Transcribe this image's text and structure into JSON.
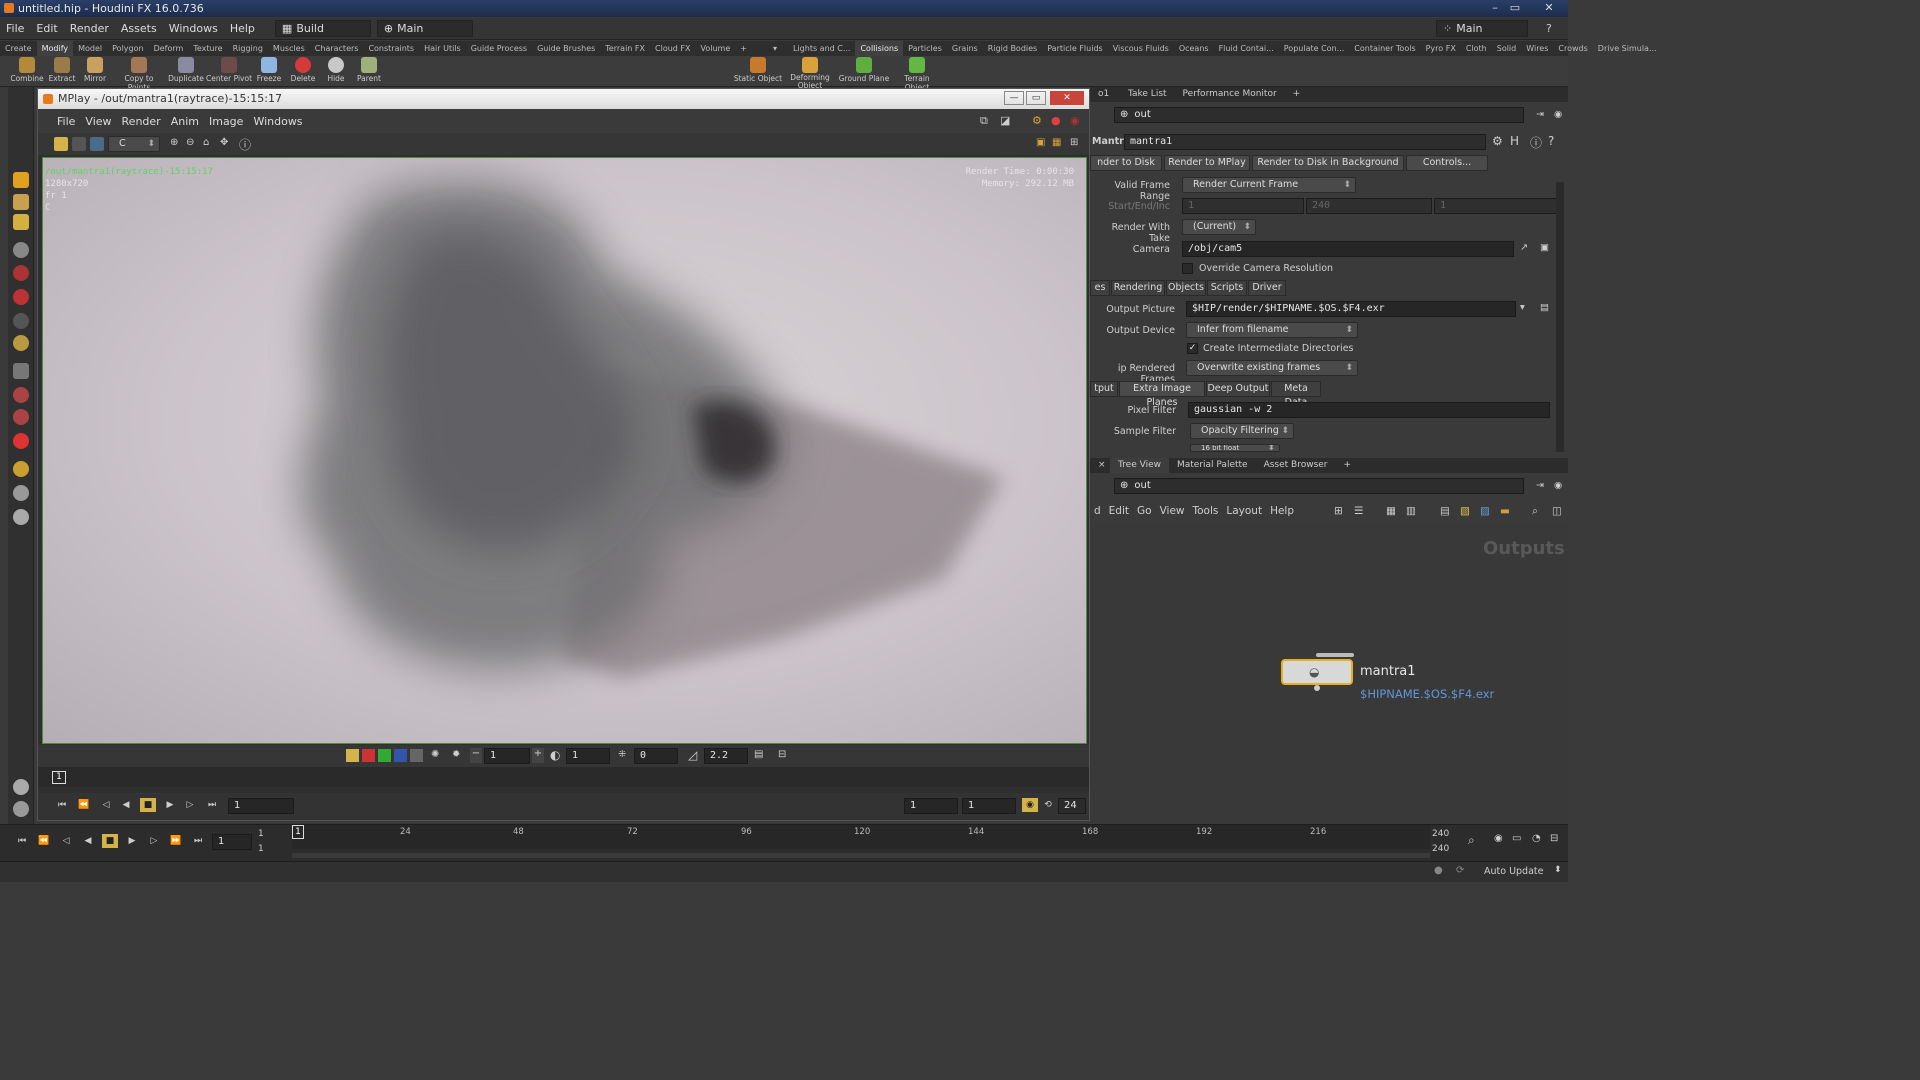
{
  "window": {
    "title": "untitled.hip - Houdini FX 16.0.736"
  },
  "menubar": {
    "items": [
      "File",
      "Edit",
      "Render",
      "Assets",
      "Windows",
      "Help"
    ],
    "desktop": "Build",
    "network": "Main",
    "right_desktop": "Main"
  },
  "shelf": {
    "tabs_left": [
      "Create",
      "Modify",
      "Model",
      "Polygon",
      "Deform",
      "Texture",
      "Rigging",
      "Muscles",
      "Characters",
      "Constraints",
      "Hair Utils",
      "Guide Process",
      "Guide Brushes",
      "Terrain FX",
      "Cloud FX",
      "Volume"
    ],
    "tabs_right": [
      "Lights and C...",
      "Collisions",
      "Particles",
      "Grains",
      "Rigid Bodies",
      "Particle Fluids",
      "Viscous Fluids",
      "Oceans",
      "Fluid Contai...",
      "Populate Con...",
      "Container Tools",
      "Pyro FX",
      "Cloth",
      "Solid",
      "Wires",
      "Crowds",
      "Drive Simula..."
    ],
    "tools_left": [
      "Combine",
      "Extract",
      "Mirror",
      "Copy to Points",
      "Duplicate",
      "Center Pivot",
      "Freeze",
      "Delete",
      "Hide",
      "Parent"
    ],
    "tools_right": [
      "Static Object",
      "Deforming Object",
      "Ground Plane",
      "Terrain Object"
    ]
  },
  "mplay": {
    "title": "MPlay - /out/mantra1(raytrace)-15:15:17",
    "menu": [
      "File",
      "View",
      "Render",
      "Anim",
      "Image",
      "Windows"
    ],
    "channel": "C",
    "overlay_left": [
      "/out/mantra1(raytrace)-15:15:17",
      "1280x720",
      "fr 1",
      "C"
    ],
    "render_time": "Render Time: 0:00:30",
    "memory": "Memory:  292.12 MB",
    "gamma": "2.2",
    "exposure_fields": [
      "1",
      "1",
      "0"
    ],
    "frame_marker": "1",
    "play_frame": "1",
    "range_start": "1",
    "range_end": "1",
    "fps": "24"
  },
  "right_tabs_top": [
    "Take List",
    "Performance Monitor"
  ],
  "path_top": "out",
  "node": {
    "type": "Mantra",
    "name": "mantra1"
  },
  "buttons": {
    "render_to_disk": "nder to Disk",
    "render_to_mplay": "Render to MPlay",
    "render_bg": "Render to Disk in Background",
    "controls": "Controls..."
  },
  "params": {
    "valid_frame_range_label": "Valid Frame Range",
    "valid_frame_range": "Render Current Frame",
    "start_end_label": "Start/End/Inc",
    "start": "1",
    "end": "240",
    "inc": "1",
    "take_label": "Render With Take",
    "take": "(Current)",
    "camera_label": "Camera",
    "camera": "/obj/cam5",
    "override_label": "Override Camera Resolution",
    "tabs": [
      "es",
      "Rendering",
      "Objects",
      "Scripts",
      "Driver"
    ],
    "output_picture_label": "Output Picture",
    "output_picture": "$HIP/render/$HIPNAME.$OS.$F4.exr",
    "output_device_label": "Output Device",
    "output_device": "Infer from filename",
    "create_dirs_label": "Create Intermediate Directories",
    "skip_label": "ip Rendered Frames",
    "skip": "Overwrite existing frames",
    "subtabs": [
      "tput",
      "Extra Image Planes",
      "Deep Output",
      "Meta Data"
    ],
    "pixel_filter_label": "Pixel Filter",
    "pixel_filter": "gaussian -w 2",
    "sample_filter_label": "Sample Filter",
    "sample_filter": "Opacity Filtering",
    "partial": "16 bit float"
  },
  "network": {
    "tabs": [
      "Tree View",
      "Material Palette",
      "Asset Browser"
    ],
    "path": "out",
    "menu": [
      "d",
      "Edit",
      "Go",
      "View",
      "Tools",
      "Layout",
      "Help"
    ],
    "context_label": "Outputs",
    "node_name": "mantra1",
    "node_output": "$HIPNAME.$OS.$F4.exr"
  },
  "timeline": {
    "ticks": [
      "24",
      "48",
      "72",
      "96",
      "120",
      "144",
      "168",
      "192",
      "216"
    ],
    "current_frame": "1",
    "start_a": "1",
    "start_b": "1",
    "end_a": "240",
    "end_b": "240",
    "frame_field": "1"
  },
  "status": {
    "auto_update": "Auto Update"
  }
}
